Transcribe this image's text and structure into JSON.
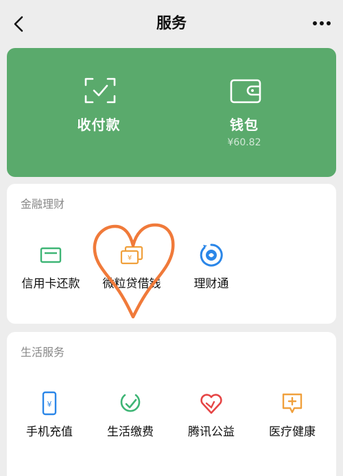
{
  "header": {
    "title": "服务"
  },
  "wallet": {
    "pay_label": "收付款",
    "wallet_label": "钱包",
    "balance": "¥60.82"
  },
  "finance": {
    "title": "金融理财",
    "items": [
      {
        "label": "信用卡还款",
        "icon": "credit-card-icon"
      },
      {
        "label": "微粒贷借钱",
        "icon": "cash-icon"
      },
      {
        "label": "理财通",
        "icon": "wealth-icon"
      }
    ]
  },
  "life": {
    "title": "生活服务",
    "items": [
      {
        "label": "手机充值",
        "icon": "phone-icon"
      },
      {
        "label": "生活缴费",
        "icon": "bill-icon"
      },
      {
        "label": "腾讯公益",
        "icon": "charity-heart-icon"
      },
      {
        "label": "医疗健康",
        "icon": "medical-icon"
      }
    ]
  },
  "colors": {
    "wallet_green": "#5aaa6c",
    "icon_green": "#3eb575",
    "icon_orange": "#f0a03c",
    "icon_blue": "#2a86e8",
    "icon_red": "#e64545",
    "heart_stroke": "#f07a3a"
  }
}
